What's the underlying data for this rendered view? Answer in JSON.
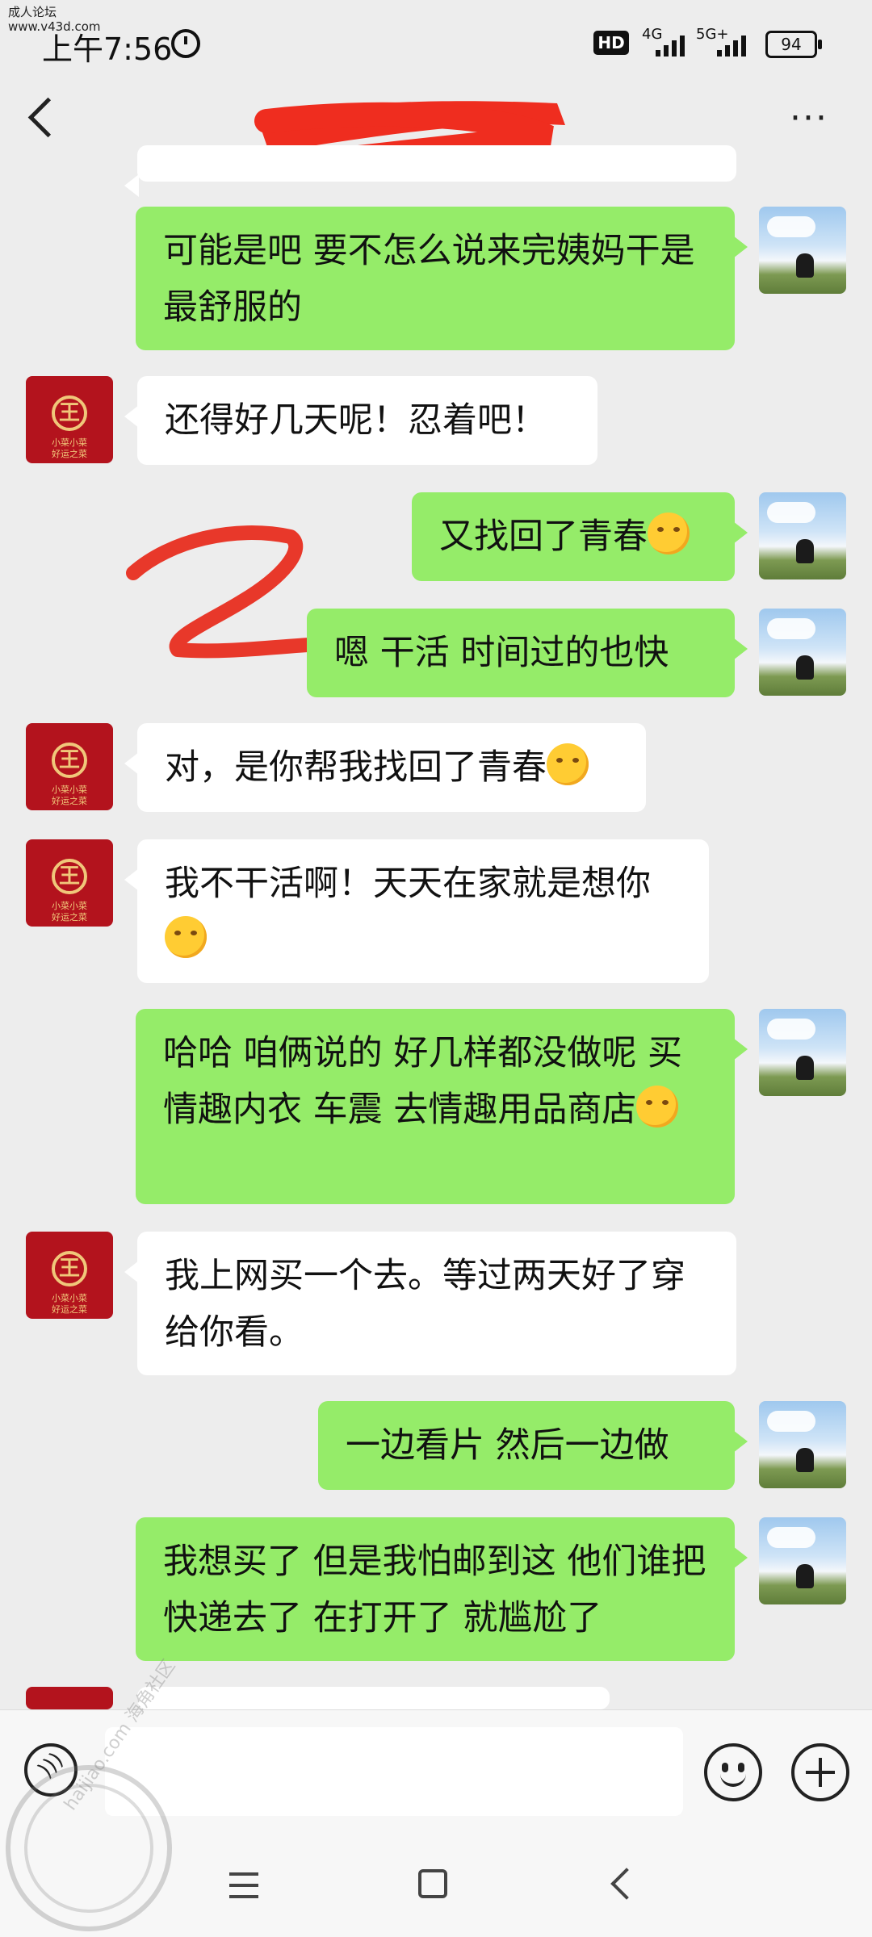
{
  "status_bar": {
    "watermark_site_name": "成人论坛",
    "watermark_site_url": "www.v43d.com",
    "time": "上午7:56",
    "hd_label": "HD",
    "network_1": "4G",
    "network_2": "5G+",
    "battery": "94"
  },
  "header": {
    "title": "",
    "more_label": "···"
  },
  "messages": [
    {
      "side": "me",
      "text": "可能是吧   要不怎么说来完姨妈干是最舒服的"
    },
    {
      "side": "them",
      "text": "还得好几天呢！忍着吧！"
    },
    {
      "side": "me",
      "text": "又找回了青春",
      "emoji": "smirk-face-emoji"
    },
    {
      "side": "me",
      "text": "嗯  干活  时间过的也快"
    },
    {
      "side": "them",
      "text": "对，是你帮我找回了青春",
      "emoji": "grin-face-emoji"
    },
    {
      "side": "them",
      "text": "我不干活啊！天天在家就是想你",
      "emoji": "pensive-face-emoji"
    },
    {
      "side": "me",
      "text": "哈哈  咱俩说的   好几样都没做呢   买情趣内衣  车震   去情趣用品商店",
      "emoji": "smirk-face-emoji"
    },
    {
      "side": "them",
      "text": "我上网买一个去。等过两天好了穿给你看。"
    },
    {
      "side": "me",
      "text": "一边看片   然后一边做"
    },
    {
      "side": "me",
      "text": "我想买了 但是我怕邮到这   他们谁把快递去了   在打开了  就尴尬了"
    }
  ],
  "avatars": {
    "them_seal_char": "王",
    "them_sub_1": "小菜小菜",
    "them_sub_2": "好运之菜"
  },
  "input_bar": {
    "placeholder": "",
    "voice_icon": "voice-icon",
    "emoji_icon": "emoji-icon",
    "plus_icon": "plus-icon"
  },
  "watermark_bottom": "haijiao.com 海角社区",
  "colors": {
    "background": "#ededed",
    "my_bubble": "#95ec69",
    "their_bubble": "#ffffff",
    "scribble": "#e8382a"
  }
}
